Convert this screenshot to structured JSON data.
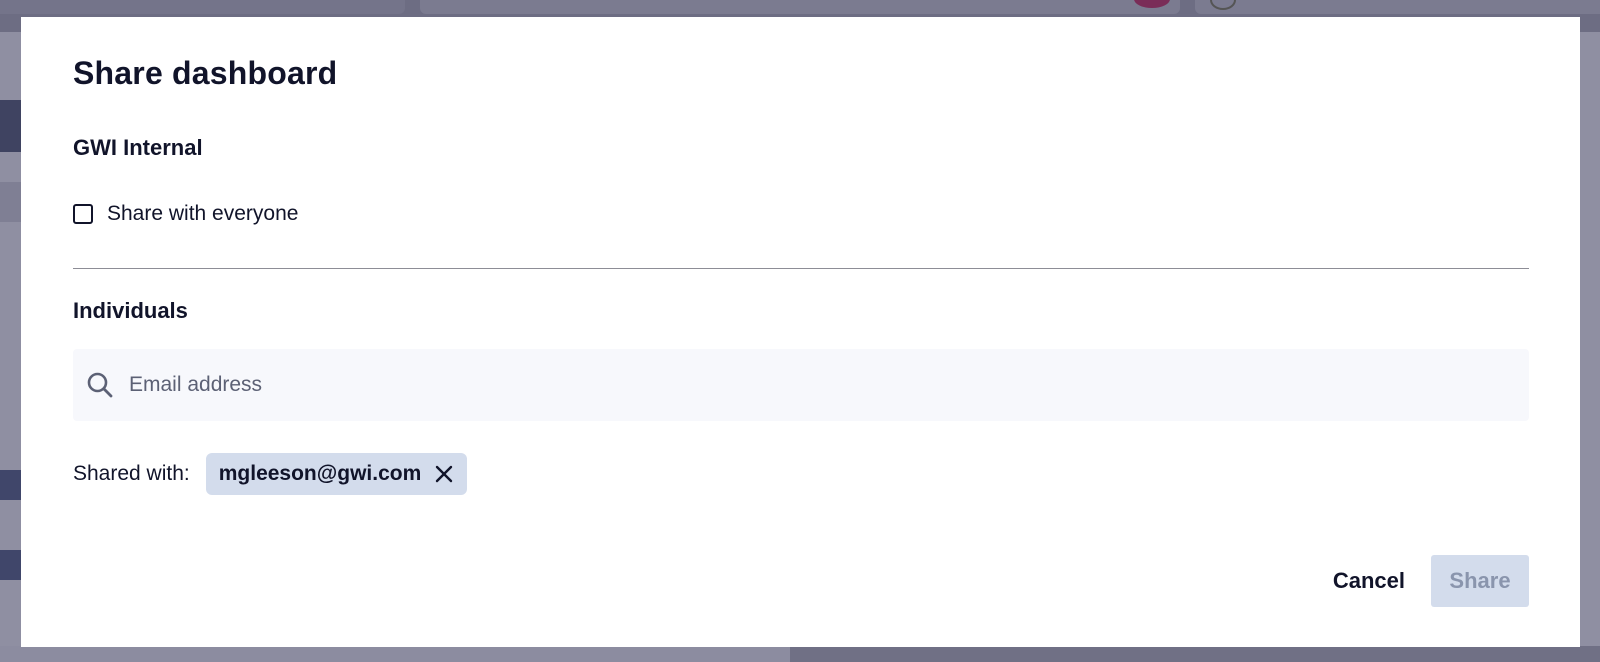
{
  "modal": {
    "title": "Share dashboard"
  },
  "internal": {
    "heading": "GWI Internal",
    "share_everyone_label": "Share with everyone",
    "share_everyone_checked": false
  },
  "individuals": {
    "heading": "Individuals",
    "search_placeholder": "Email address",
    "search_value": "",
    "shared_with_label": "Shared with:",
    "shared_with": [
      "mgleeson@gwi.com"
    ]
  },
  "actions": {
    "cancel_label": "Cancel",
    "share_label": "Share",
    "share_enabled": false
  },
  "colors": {
    "text_primary": "#11142a",
    "chip_bg": "#d3dcec",
    "share_button_bg": "#d3dcec",
    "share_button_text": "#8a95ad",
    "search_bg": "#f7f8fc",
    "overlay": "#6e6e82"
  },
  "icons": {
    "checkbox": "checkbox-unchecked-icon",
    "search": "search-icon",
    "chip_remove": "close-icon"
  }
}
